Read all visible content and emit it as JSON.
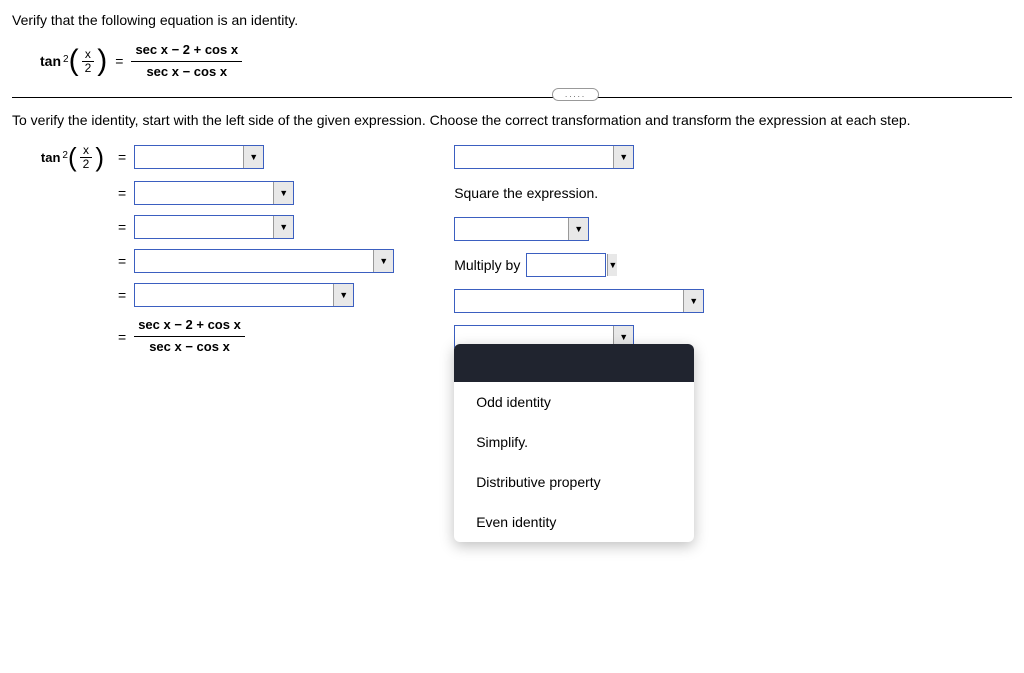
{
  "instruction": "Verify that the following equation is an identity.",
  "given": {
    "left_func": "tan",
    "left_exp": "2",
    "left_arg_num": "x",
    "left_arg_den": "2",
    "rhs_num": "sec x − 2 + cos x",
    "rhs_den": "sec x − cos x"
  },
  "step_text": "To verify the identity, start with the left side of the given expression. Choose the correct transformation and transform the expression at each step.",
  "right_labels": {
    "square": "Square the expression.",
    "multiply": "Multiply by"
  },
  "final": {
    "num": "sec x − 2 + cos x",
    "den": "sec x − cos x"
  },
  "dropdown_options": [
    "Odd identity",
    "Simplify.",
    "Distributive property",
    "Even identity"
  ],
  "bubble": "....."
}
